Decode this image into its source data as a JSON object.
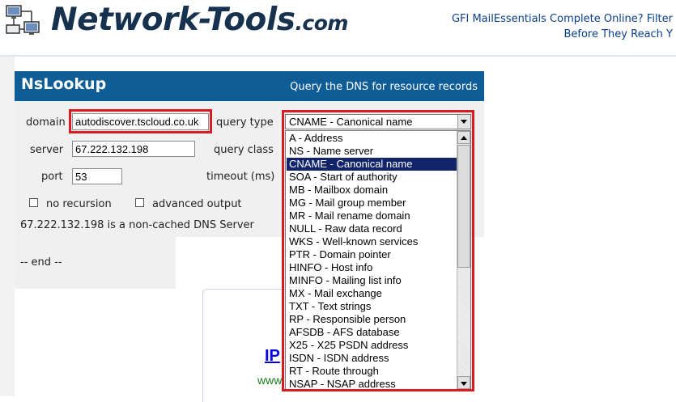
{
  "header": {
    "logo_text": "Network-Tools",
    "logo_suffix": ".com",
    "ad_line1": "GFI MailEssentials Complete Online? Filter",
    "ad_line2": "Before They Reach Y"
  },
  "tool": {
    "title": "NsLookup",
    "subtitle": "Query the DNS for resource records"
  },
  "form": {
    "domain_label": "domain",
    "domain_value": "autodiscover.tscloud.co.uk",
    "query_type_label": "query type",
    "query_type_selected": "CNAME - Canonical name",
    "server_label": "server",
    "server_value": "67.222.132.198",
    "query_class_label": "query class",
    "port_label": "port",
    "port_value": "53",
    "timeout_label": "timeout (ms)",
    "no_recursion_label": "no recursion",
    "advanced_output_label": "advanced output",
    "status_text": "67.222.132.198 is a non-cached DNS Server",
    "end_text": "-- end --"
  },
  "dropdown": {
    "items": [
      "A - Address",
      "NS - Name server",
      "CNAME - Canonical name",
      "SOA - Start of authority",
      "MB - Mailbox domain",
      "MG - Mail group member",
      "MR - Mail rename domain",
      "NULL - Raw data record",
      "WKS - Well-known services",
      "PTR - Domain pointer",
      "HINFO - Host info",
      "MINFO - Mailing list info",
      "MX - Mail exchange",
      "TXT - Text strings",
      "RP - Responsible person",
      "AFSDB - AFS database",
      "X25 - X25 PSDN address",
      "ISDN - ISDN address",
      "RT - Route through",
      "NSAP - NSAP address"
    ],
    "selected_index": 2
  },
  "ad_box": {
    "link_text": "IP",
    "www_text": "www"
  },
  "colors": {
    "header_blue": "#0f5d97",
    "highlight_red": "#d91c24",
    "selection_navy": "#12256b"
  }
}
